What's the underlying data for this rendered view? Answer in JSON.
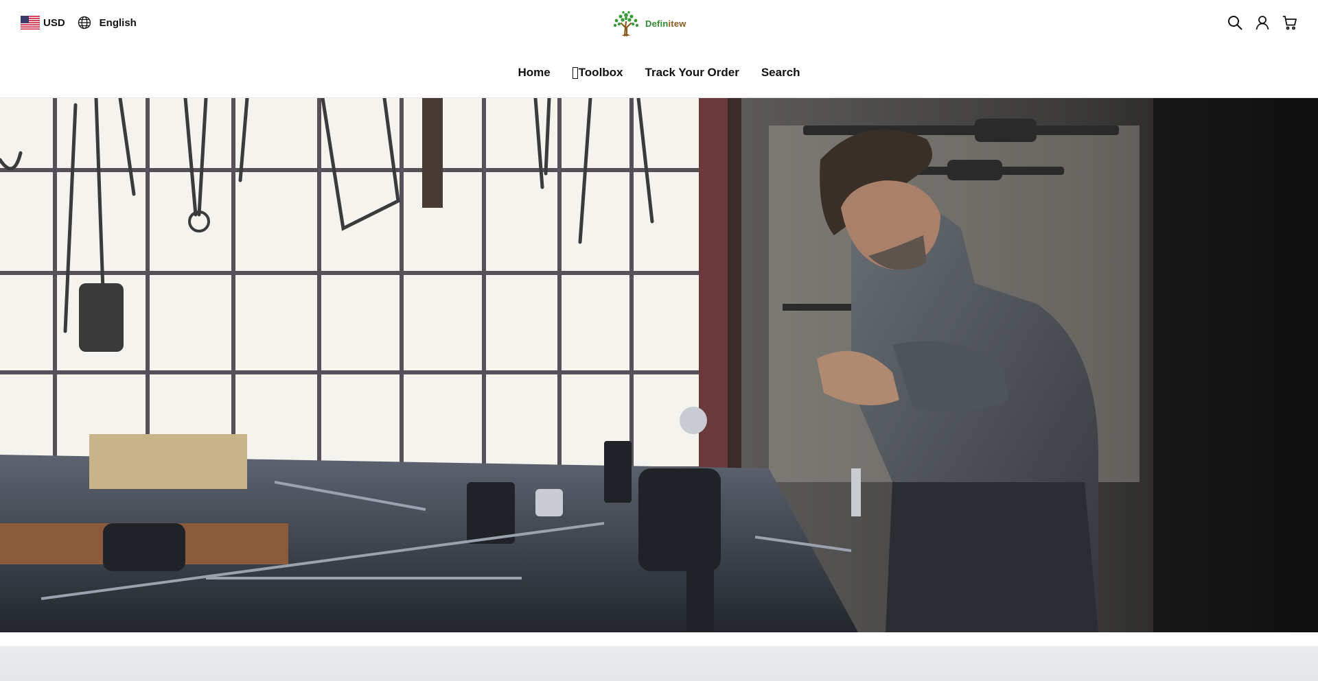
{
  "header": {
    "currency": "USD",
    "currency_flag": "us-flag-icon",
    "language": "English",
    "brand": {
      "part1": "Defin",
      "part2": "itew",
      "color1": "#2e8b2e",
      "color2": "#8a5a1e"
    },
    "icons": [
      "search-icon",
      "account-icon",
      "cart-icon"
    ]
  },
  "nav": {
    "items": [
      {
        "label": "Home"
      },
      {
        "label": "Toolbox"
      },
      {
        "label": "Track Your Order"
      },
      {
        "label": "Search"
      }
    ]
  },
  "colors": {
    "text": "#111111",
    "background": "#ffffff",
    "band": "#e6e9eb"
  }
}
